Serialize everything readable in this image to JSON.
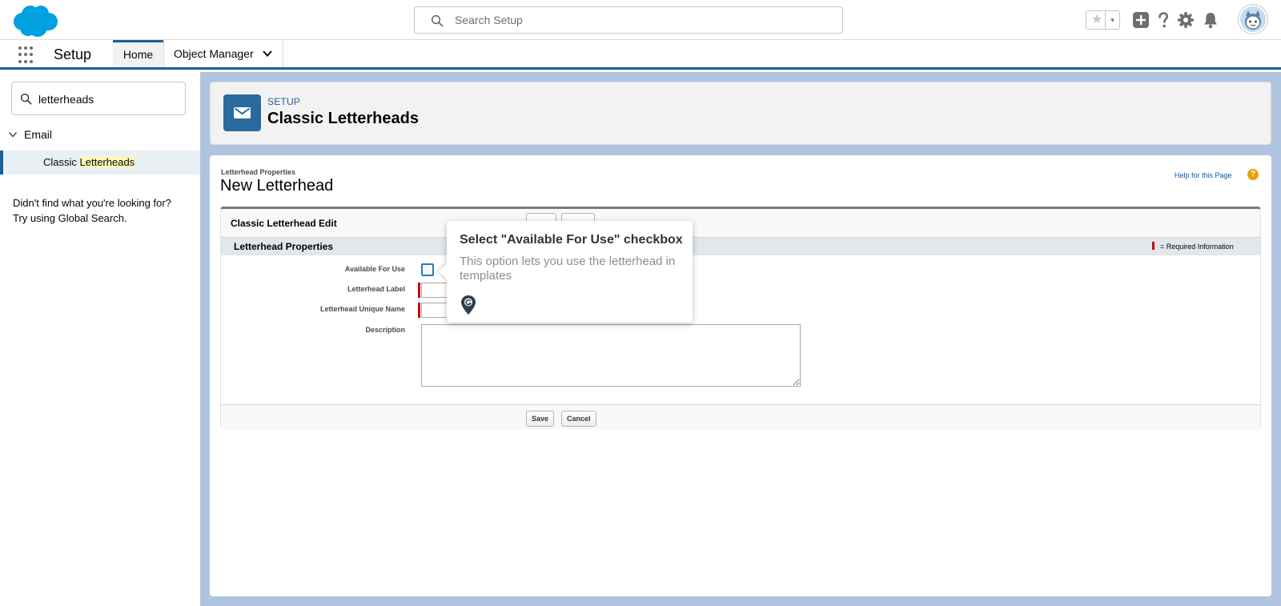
{
  "header": {
    "search_placeholder": "Search Setup",
    "favorite_star": "★",
    "favorite_caret": "▾",
    "icons": [
      "star-icon",
      "add-icon",
      "help-icon",
      "gear-icon",
      "bell-icon",
      "avatar"
    ]
  },
  "context_bar": {
    "app_name": "Setup",
    "tabs": [
      {
        "label": "Home",
        "active": true
      },
      {
        "label": "Object Manager",
        "has_dropdown": true
      }
    ]
  },
  "sidebar": {
    "quick_find_value": "letterheads",
    "tree": {
      "group": "Email",
      "item_prefix": "Classic ",
      "item_highlight": "Letterheads"
    },
    "not_found_line1": "Didn't find what you're looking for?",
    "not_found_line2": "Try using Global Search."
  },
  "page_header": {
    "eyebrow": "SETUP",
    "title": "Classic Letterheads"
  },
  "content": {
    "breadcrumb": "Letterhead Properties",
    "title": "New Letterhead",
    "help_link": "Help for this Page",
    "help_icon": "?",
    "block_title": "Classic Letterhead Edit",
    "section_title": "Letterhead Properties",
    "required_legend": "= Required Information",
    "fields": {
      "available_for_use": "Available For Use",
      "letterhead_label": "Letterhead Label",
      "unique_name": "Letterhead Unique Name",
      "description": "Description"
    },
    "save_label": "Save",
    "cancel_label": "Cancel"
  },
  "tooltip": {
    "title": "Select \"Available For Use\" checkbox",
    "body": "This option lets you use the letterhead in templates"
  },
  "colors": {
    "brand_blue": "#1b5f9e",
    "main_background": "#b0c4df",
    "icon_tile": "#2b6a9e",
    "required_red": "#cc0000",
    "help_orange": "#e8a202"
  }
}
